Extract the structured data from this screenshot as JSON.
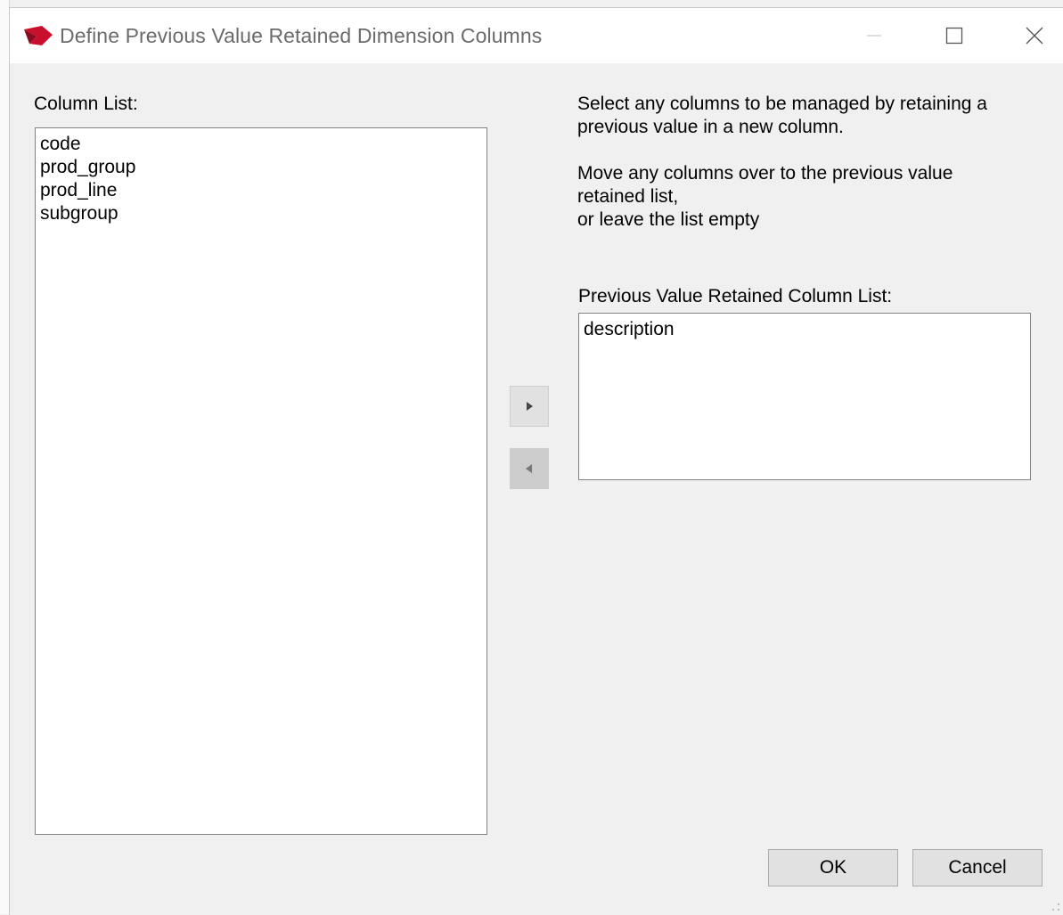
{
  "window": {
    "title": "Define Previous Value Retained Dimension Columns",
    "icon": "wherescape-logo-icon",
    "accent": "#c8102e"
  },
  "left": {
    "label": "Column List:",
    "items": [
      "code",
      "prod_group",
      "prod_line",
      "subgroup"
    ]
  },
  "info": {
    "line1": "Select any columns to be managed by retaining a",
    "line2": "previous value in a new column.",
    "line3": "Move any columns over to the previous value",
    "line4": "retained list,",
    "line5": "or leave the list empty"
  },
  "right": {
    "label": "Previous Value Retained Column List:",
    "items": [
      "description"
    ]
  },
  "buttons": {
    "move_right_icon": "triangle-right-icon",
    "move_left_icon": "triangle-left-icon",
    "ok": "OK",
    "cancel": "Cancel"
  }
}
